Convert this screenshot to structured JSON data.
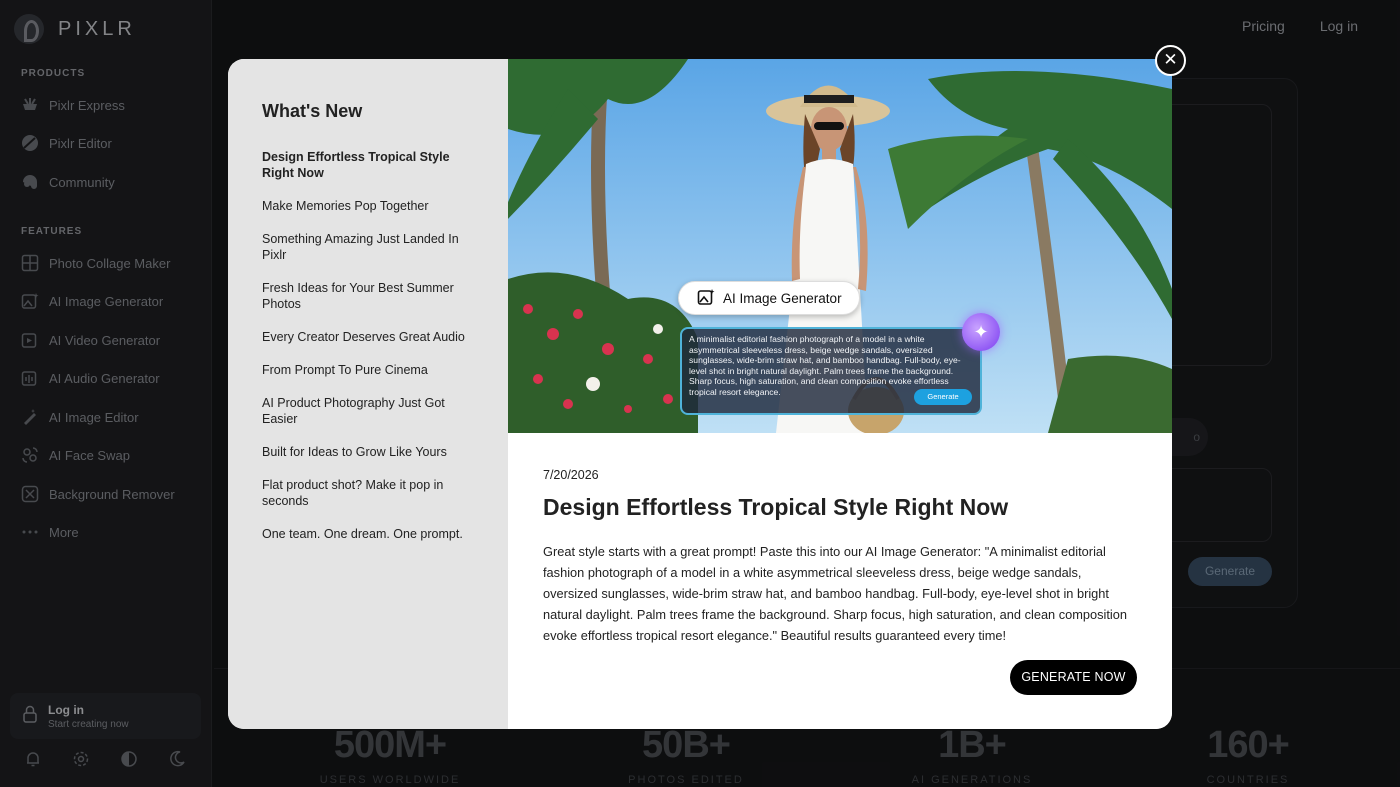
{
  "brand": {
    "name": "PIXLR"
  },
  "topnav": {
    "pricing": "Pricing",
    "login": "Log in"
  },
  "sidebar": {
    "products_title": "PRODUCTS",
    "products": [
      {
        "label": "Pixlr Express",
        "icon": "express-icon"
      },
      {
        "label": "Pixlr Editor",
        "icon": "editor-icon"
      },
      {
        "label": "Community",
        "icon": "community-icon"
      }
    ],
    "features_title": "FEATURES",
    "features": [
      {
        "label": "Photo Collage Maker",
        "icon": "collage-icon"
      },
      {
        "label": "AI Image Generator",
        "icon": "image-generator-icon"
      },
      {
        "label": "AI Video Generator",
        "icon": "video-generator-icon"
      },
      {
        "label": "AI Audio Generator",
        "icon": "audio-generator-icon"
      },
      {
        "label": "AI Image Editor",
        "icon": "image-editor-icon"
      },
      {
        "label": "AI Face Swap",
        "icon": "face-swap-icon"
      },
      {
        "label": "Background Remover",
        "icon": "background-remover-icon"
      },
      {
        "label": "More",
        "icon": "more-icon"
      }
    ],
    "login_title": "Log in",
    "login_subtitle": "Start creating now"
  },
  "background": {
    "partial_button": "o",
    "generate": "Generate",
    "stats": [
      {
        "value": "500M+",
        "label": "USERS WORLDWIDE"
      },
      {
        "value": "50B+",
        "label": "PHOTOS EDITED"
      },
      {
        "value": "1B+",
        "label": "AI GENERATIONS"
      },
      {
        "value": "160+",
        "label": "COUNTRIES"
      }
    ]
  },
  "modal": {
    "heading": "What's New",
    "items": [
      "Design Effortless Tropical Style Right Now",
      "Make Memories Pop Together",
      "Something Amazing Just Landed In Pixlr",
      "Fresh Ideas for Your Best Summer Photos",
      "Every Creator Deserves Great Audio",
      "From Prompt To Pure Cinema",
      "AI Product Photography Just Got Easier",
      "Built for Ideas to Grow Like Yours",
      "Flat product shot? Make it pop in seconds",
      "One team. One dream. One prompt."
    ],
    "active_index": 0,
    "hero": {
      "chip_label": "AI Image Generator",
      "prompt": "A minimalist editorial fashion photograph of a model in a white asymmetrical sleeveless dress, beige wedge sandals, oversized sunglasses, wide-brim straw hat, and bamboo handbag. Full-body, eye-level shot in bright natural daylight. Palm trees frame the background. Sharp focus, high saturation, and clean composition evoke effortless tropical resort elegance.",
      "prompt_button": "Generate"
    },
    "date": "7/20/2026",
    "title": "Design Effortless Tropical Style Right Now",
    "body": "Great style starts with a great prompt! Paste this into our AI Image Generator: \"A minimalist editorial fashion photograph of a model in a white asymmetrical sleeveless dress, beige wedge sandals, oversized sunglasses, wide-brim straw hat, and bamboo handbag. Full-body, eye-level shot in bright natural daylight. Palm trees frame the background. Sharp focus, high saturation, and clean composition evoke effortless tropical resort elegance.\" Beautiful results guaranteed every time!",
    "cta": "GENERATE NOW",
    "close_symbol": "✕"
  }
}
